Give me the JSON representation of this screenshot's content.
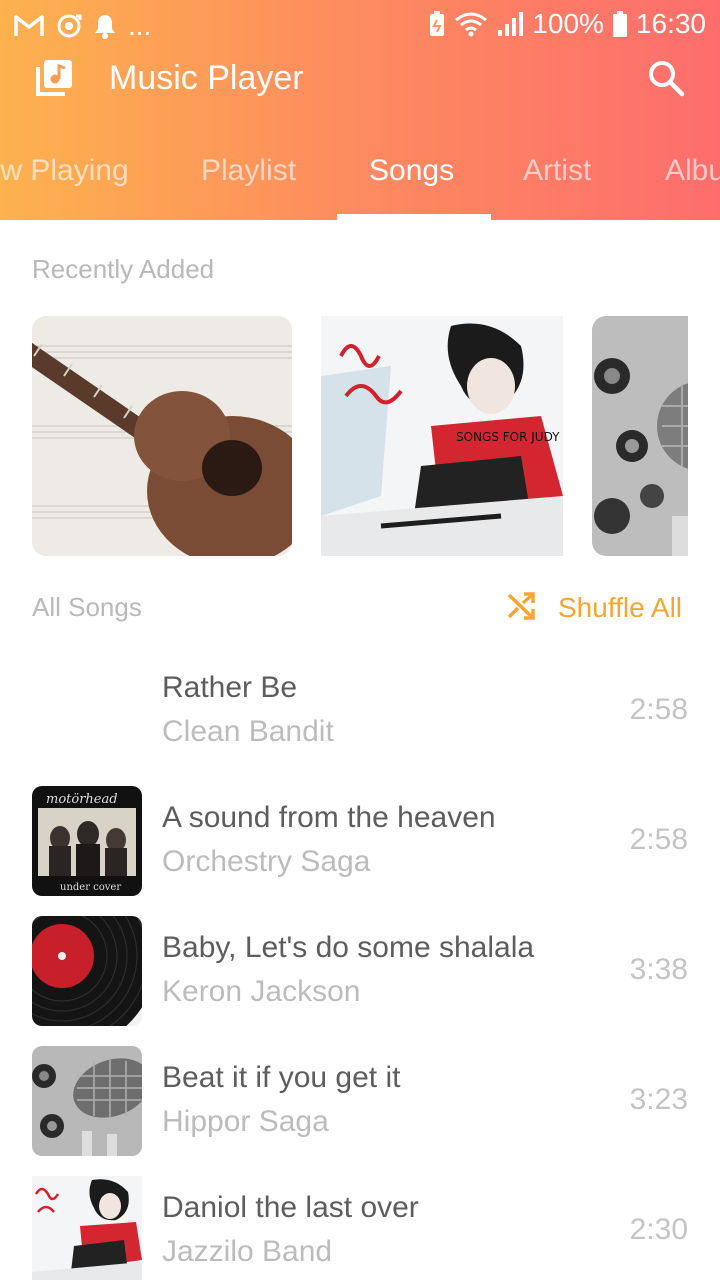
{
  "status_bar": {
    "battery": "100%",
    "time": "16:30",
    "overflow": "...",
    "icons": [
      "gmail-icon",
      "sync-icon",
      "notification-bell-icon",
      "battery-saver-icon",
      "wifi-icon",
      "signal-icon",
      "battery-icon"
    ]
  },
  "toolbar": {
    "title": "Music Player",
    "app_icon": "music-library-icon",
    "search_icon": "search-icon"
  },
  "tabs": [
    {
      "label": "Now Playing",
      "active": false
    },
    {
      "label": "Playlist",
      "active": false
    },
    {
      "label": "Songs",
      "active": true
    },
    {
      "label": "Artist",
      "active": false
    },
    {
      "label": "Albums",
      "active": false
    }
  ],
  "recently_added": {
    "label": "Recently Added",
    "items": [
      {
        "art": "ukulele-on-sheet-music"
      },
      {
        "art": "neil-young-songs-for-judy"
      },
      {
        "art": "mixer-and-microphone"
      }
    ]
  },
  "all_songs": {
    "label": "All Songs",
    "shuffle_label": "Shuffle All",
    "shuffle_icon": "shuffle-icon"
  },
  "songs": [
    {
      "title": "Rather Be",
      "artist": "Clean Bandit",
      "duration": "2:58",
      "art": "none"
    },
    {
      "title": "A sound from the heaven",
      "artist": "Orchestry Saga",
      "duration": "2:58",
      "art": "motorhead-under-cover"
    },
    {
      "title": "Baby, Let's do some shalala",
      "artist": "Keron Jackson",
      "duration": "3:38",
      "art": "vinyl-record"
    },
    {
      "title": "Beat it if you get it",
      "artist": "Hippor Saga",
      "duration": "3:23",
      "art": "mixer-and-microphone"
    },
    {
      "title": "Daniol the last over",
      "artist": "Jazzilo Band",
      "duration": "2:30",
      "art": "neil-young-songs-for-judy"
    }
  ],
  "colors": {
    "header_gradient_start": "#fdb24e",
    "header_gradient_end": "#fd6d6d",
    "accent": "#f8a535",
    "title_text": "#5d5d5d",
    "secondary_text": "#bcbcbc"
  }
}
